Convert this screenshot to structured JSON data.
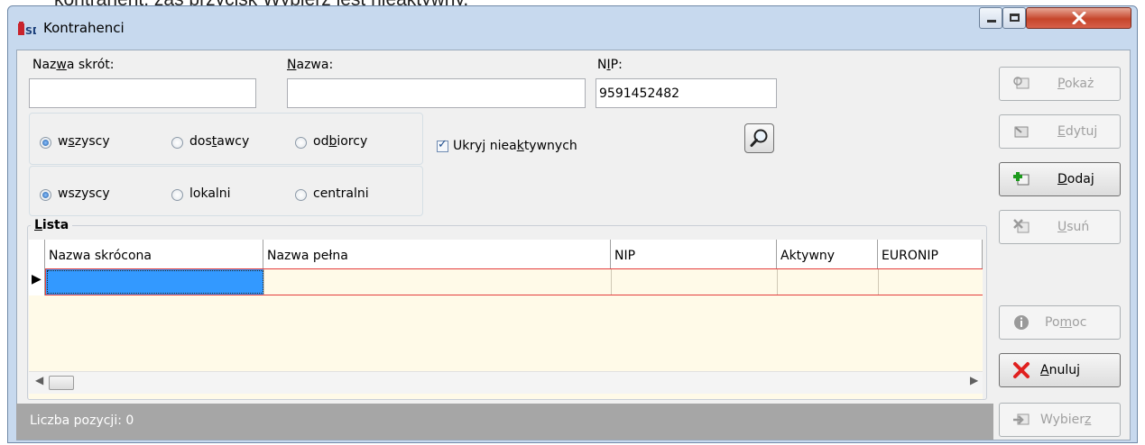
{
  "document": {
    "text_above": "kontrahent, zaś przycisk Wybierz jest nieaktywny."
  },
  "window": {
    "title": "Kontrahenci",
    "icon": "app-logo-icon",
    "controls": {
      "minimize": "minimize-icon",
      "maximize": "maximize-icon",
      "close": "close-icon"
    }
  },
  "filters": {
    "nazwa_skrot": {
      "label_pre": "Naz",
      "label_u": "w",
      "label_post": "a skrót:",
      "value": ""
    },
    "nazwa": {
      "label_pre": "",
      "label_u": "N",
      "label_post": "azwa:",
      "value": ""
    },
    "nip": {
      "label_pre": "N",
      "label_u": "I",
      "label_post": "P:",
      "value": "9591452482"
    },
    "type_group": [
      {
        "pre": "w",
        "u": "s",
        "post": "zyscy",
        "selected": true
      },
      {
        "pre": "dos",
        "u": "t",
        "post": "awcy",
        "selected": false
      },
      {
        "pre": "od",
        "u": "b",
        "post": "iorcy",
        "selected": false
      }
    ],
    "scope_group": [
      {
        "label": "wszyscy",
        "selected": true
      },
      {
        "label": "lokalni",
        "selected": false
      },
      {
        "label": "centralni",
        "selected": false
      }
    ],
    "hide_inactive": {
      "pre": "Ukryj niea",
      "u": "k",
      "post": "tywnych",
      "checked": true
    },
    "search_icon": "magnifier-icon"
  },
  "list": {
    "legend_u": "L",
    "legend_rest": "ista",
    "columns": [
      "Nazwa skrócona",
      "Nazwa pełna",
      "NIP",
      "Aktywny",
      "EURONIP"
    ],
    "rows": [
      [
        "",
        "",
        "",
        "",
        ""
      ]
    ],
    "row_indicator": "▶"
  },
  "status": {
    "text": "Liczba pozycji: 0"
  },
  "buttons": [
    {
      "id": "pokaz",
      "pre": "",
      "u": "P",
      "post": "okaż",
      "enabled": false,
      "icon": "show-card-icon"
    },
    {
      "id": "edytuj",
      "pre": "",
      "u": "E",
      "post": "dytuj",
      "enabled": false,
      "icon": "edit-card-icon"
    },
    {
      "id": "dodaj",
      "pre": "",
      "u": "D",
      "post": "odaj",
      "enabled": true,
      "icon": "add-card-icon"
    },
    {
      "id": "usun",
      "pre": "",
      "u": "U",
      "post": "suń",
      "enabled": false,
      "icon": "delete-card-icon"
    },
    {
      "id": "pomoc",
      "pre": "Po",
      "u": "m",
      "post": "oc",
      "enabled": false,
      "icon": "info-icon"
    },
    {
      "id": "anuluj",
      "pre": "",
      "u": "A",
      "post": "nuluj",
      "enabled": true,
      "icon": "cancel-x-icon"
    },
    {
      "id": "wybierz",
      "pre": "Wybier",
      "u": "z",
      "post": "",
      "enabled": false,
      "icon": "select-card-icon"
    }
  ]
}
